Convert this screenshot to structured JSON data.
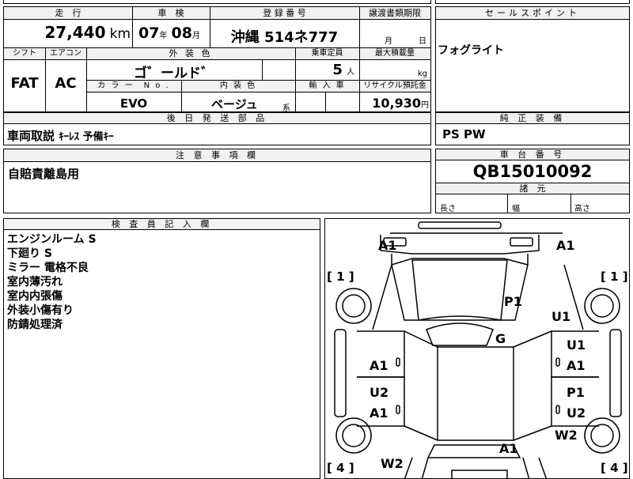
{
  "top_main": {
    "mileage_header": "走　行",
    "mileage_value": "27,440",
    "mileage_unit": "km",
    "inspection_header": "車　検",
    "inspection_year": "07",
    "inspection_year_unit": "年",
    "inspection_month": "08",
    "inspection_month_unit": "月",
    "registration_header": "登 録 番 号",
    "registration_value": "沖縄 514ネ777",
    "transfer_header": "譲渡書類期限",
    "transfer_month_unit": "月",
    "transfer_day_unit": "日",
    "shift_header": "シフト",
    "shift_value": "FAT",
    "ac_header": "エアコン",
    "ac_value": "AC",
    "exterior_header": "外 装 色",
    "exterior_value": "ゴ゛ールド゛",
    "capacity_header": "乗車定員",
    "capacity_value": "5",
    "capacity_unit": "人",
    "load_header": "最大積載量",
    "load_unit": "kg",
    "color_no_header": "カ ラ ー　N o .",
    "color_no_value": "EVO",
    "interior_header": "内 装 色",
    "interior_value": "ベージュ",
    "interior_suffix": "系",
    "import_header": "輸 入 車",
    "recycle_header": "リサイクル預託金",
    "recycle_value": "10,930",
    "recycle_unit": "円"
  },
  "sales_point": {
    "header": "セールスポイント",
    "content": "フォグライト"
  },
  "later_parts": {
    "header": "後 日 発 送 部 品",
    "content_bold": "車両取説",
    "content_rest": "ｷｰﾚｽ 予備ｷｰ"
  },
  "genuine_equipment": {
    "header": "純 正 装 備",
    "content": "PS PW"
  },
  "caution": {
    "header": "注 意 事 項 欄",
    "content": "自賠責離島用"
  },
  "chassis": {
    "header": "車 台 番 号",
    "value": "QB15010092"
  },
  "dimensions": {
    "header": "諸　元",
    "length": "長さ",
    "width": "幅",
    "height": "高さ"
  },
  "inspector_notes": {
    "header": "検 査 員 記 入 欄",
    "lines": [
      "エンジンルーム S",
      "下廻り S",
      "ミラー 電格不良",
      "室内薄汚れ",
      "室内内張傷",
      "外装小傷有り",
      "防錆処理済"
    ]
  },
  "diagram": {
    "labels": {
      "front_left": "A1",
      "front_right": "A1",
      "bonnet": "P1",
      "front_fender_right": "U1",
      "roof": "G",
      "right_front_door_top": "U1",
      "right_front_door_bottom": "A1",
      "left_front_door": "A1",
      "left_rear_door_top": "U2",
      "left_rear_door_bottom": "A1",
      "right_rear_door_top": "P1",
      "right_rear_door_bottom": "U2",
      "right_rear_fender": "W2",
      "trunk": "A1",
      "left_rear_fender": "W2"
    },
    "brackets": {
      "left_top": "[ 1 ]",
      "right_top": "[ 1 ]",
      "left_bottom": "[ 4 ]",
      "right_bottom": "[ 4 ]"
    }
  }
}
